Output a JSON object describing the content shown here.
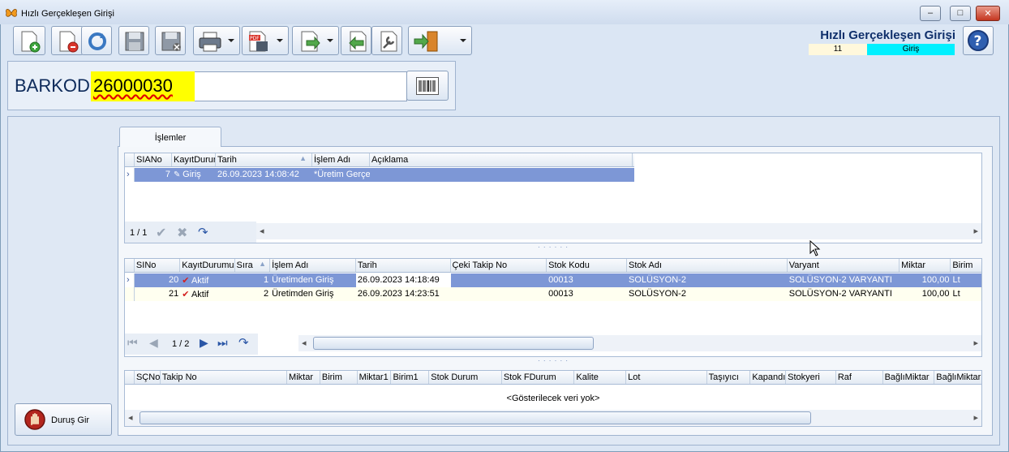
{
  "window": {
    "title": "Hızlı Gerçekleşen Girişi",
    "controls": [
      "minimize",
      "maximize",
      "close"
    ]
  },
  "toolbar": {
    "buttons": [
      {
        "name": "new-document-icon"
      },
      {
        "name": "delete-document-icon"
      },
      {
        "name": "refresh-icon"
      },
      {
        "name": "save-icon"
      },
      {
        "name": "save-cancel-icon"
      },
      {
        "name": "print-icon"
      },
      {
        "name": "pdf-export-icon"
      },
      {
        "name": "export-icon"
      },
      {
        "name": "back-icon"
      },
      {
        "name": "tools-icon"
      },
      {
        "name": "exit-door-icon"
      }
    ]
  },
  "header": {
    "title": "Hızlı Gerçekleşen Girişi",
    "count": "11",
    "state": "Giriş"
  },
  "barcode": {
    "label": "BARKOD",
    "value": "26000030"
  },
  "side": {
    "stop_button": "Duruş Gir"
  },
  "tab": {
    "label": "İşlemler"
  },
  "grid1": {
    "columns": [
      "SIANo",
      "KayıtDurur",
      "Tarih",
      "İşlem Adı",
      "Açıklama"
    ],
    "rows": [
      {
        "sia_no": "7",
        "status": "Giriş",
        "date": "26.09.2023 14:08:42",
        "process": "*Üretim Gerçe",
        "desc": ""
      }
    ],
    "page": "1 / 1"
  },
  "grid2": {
    "columns": [
      "SINo",
      "KayıtDurumu",
      "Sıra",
      "İşlem Adı",
      "Tarih",
      "Çeki Takip No",
      "Stok Kodu",
      "Stok Adı",
      "Varyant",
      "Miktar",
      "Birim"
    ],
    "rows": [
      {
        "si_no": "20",
        "status": "Aktif",
        "order": "1",
        "process": "Üretimden Giriş",
        "date": "26.09.2023 14:18:49",
        "track_no": "",
        "stock_code": "00013",
        "stock_name": "SOLÜSYON-2",
        "variant": "SOLÜSYON-2 VARYANTI",
        "qty": "100,00",
        "unit": "Lt"
      },
      {
        "si_no": "21",
        "status": "Aktif",
        "order": "2",
        "process": "Üretimden Giriş",
        "date": "26.09.2023 14:23:51",
        "track_no": "",
        "stock_code": "00013",
        "stock_name": "SOLÜSYON-2",
        "variant": "SOLÜSYON-2 VARYANTI",
        "qty": "100,00",
        "unit": "Lt"
      }
    ],
    "page": "1 / 2"
  },
  "grid3": {
    "columns": [
      "SÇNo",
      "Takip No",
      "Miktar",
      "Birim",
      "Miktar1",
      "Birim1",
      "Stok Durum",
      "Stok FDurum",
      "Kalite",
      "Lot",
      "Taşıyıcı",
      "Kapandı",
      "Stokyeri",
      "Raf",
      "BağlıMiktar",
      "BağlıMiktar"
    ],
    "empty_text": "<Gösterilecek veri yok>"
  },
  "colors": {
    "selection": "#7d97d6",
    "barcode_highlight": "#ffff00",
    "state_badge": "#00f0ff",
    "header_title": "#0f2f6b"
  }
}
